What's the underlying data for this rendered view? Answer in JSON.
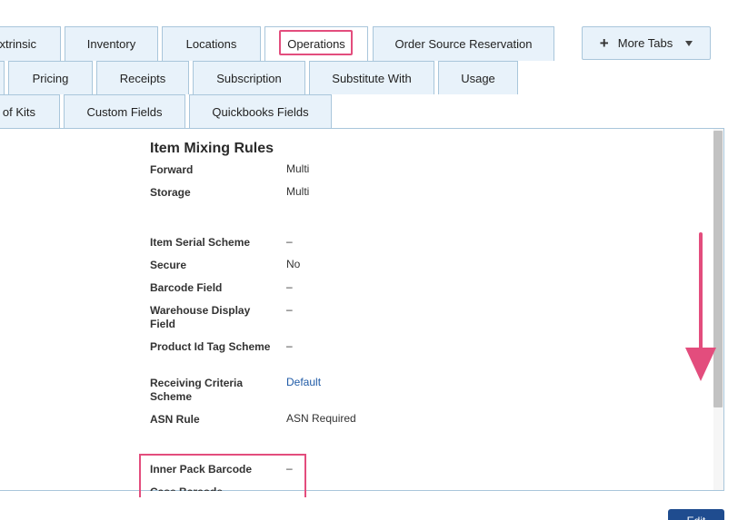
{
  "tabs": {
    "row1": [
      "xtrinsic",
      "Inventory",
      "Locations",
      "Operations",
      "Order Source Reservation"
    ],
    "row2": [
      "Pricing",
      "Receipts",
      "Subscription",
      "Substitute With",
      "Usage"
    ],
    "row3": [
      "of Kits",
      "Custom Fields",
      "Quickbooks Fields"
    ],
    "more_tabs_label": "More Tabs",
    "more_tabs_icon": "plus-icon"
  },
  "section": {
    "title": "Item Mixing Rules",
    "fields": [
      {
        "label": "Forward",
        "value": "Multi"
      },
      {
        "label": "Storage",
        "value": "Multi"
      },
      {
        "label": "Item Serial Scheme",
        "value": "–"
      },
      {
        "label": "Secure",
        "value": "No"
      },
      {
        "label": "Barcode Field",
        "value": "–"
      },
      {
        "label": "Warehouse Display Field",
        "value": "–"
      },
      {
        "label": "Product Id Tag Scheme",
        "value": "–"
      },
      {
        "label": "Receiving Criteria Scheme",
        "value": "Default"
      },
      {
        "label": "ASN Rule",
        "value": "ASN Required"
      },
      {
        "label": "Inner Pack Barcode",
        "value": "–"
      },
      {
        "label": "Case Barcode",
        "value": ""
      }
    ]
  },
  "edit_button_label": "Edit",
  "colors": {
    "highlight": "#e34d7d",
    "tab_bg": "#e8f2fa",
    "tab_border": "#a9c6db",
    "link": "#1f5aa6",
    "button": "#1f4c8f"
  }
}
